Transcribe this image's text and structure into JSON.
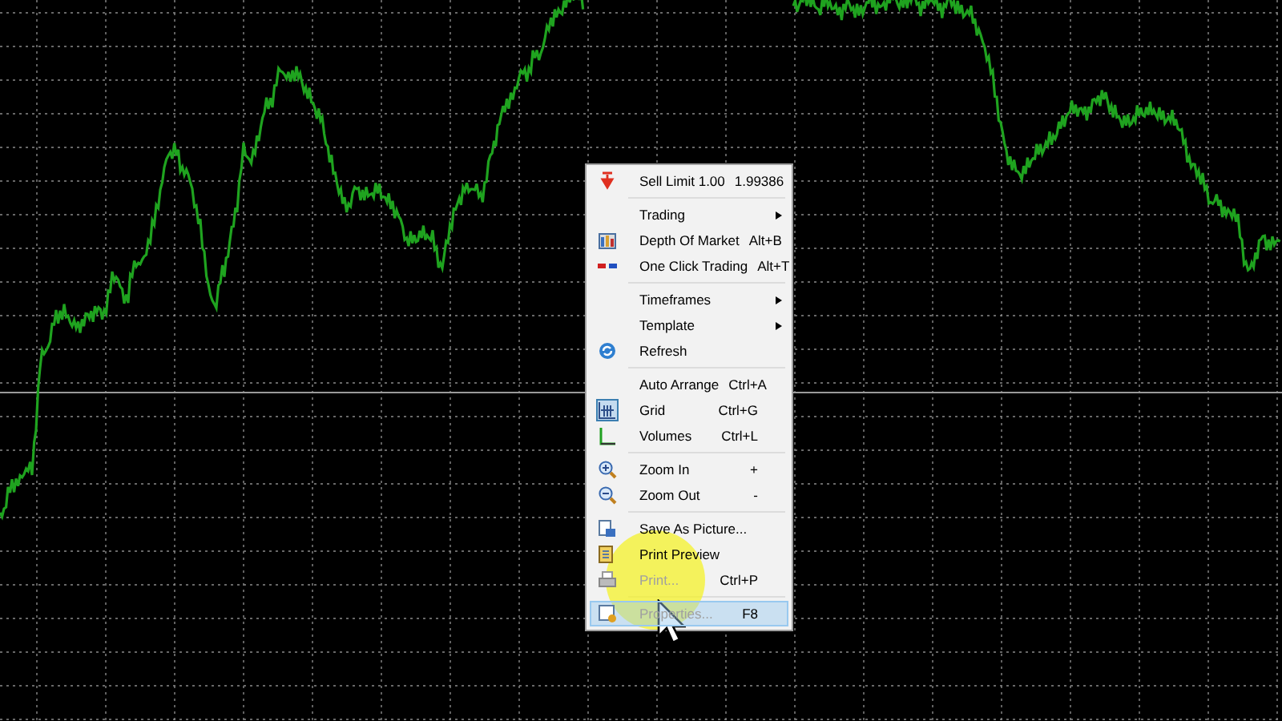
{
  "context_menu": {
    "items": [
      {
        "kind": "item",
        "label": "Sell Limit 1.00",
        "shortcut": "1.99386",
        "submenu": false,
        "checked": false,
        "disabled": false,
        "selected": false
      },
      {
        "kind": "separator"
      },
      {
        "kind": "item",
        "label": "Trading",
        "submenu": true,
        "checked": false,
        "disabled": false,
        "selected": false
      },
      {
        "kind": "item",
        "label": "Depth Of Market",
        "shortcut": "Alt+B",
        "submenu": false,
        "checked": false,
        "disabled": false,
        "selected": false
      },
      {
        "kind": "item",
        "label": "One Click Trading",
        "shortcut": "Alt+T",
        "submenu": false,
        "checked": false,
        "disabled": false,
        "selected": false
      },
      {
        "kind": "separator"
      },
      {
        "kind": "item",
        "label": "Timeframes",
        "submenu": true,
        "checked": false,
        "disabled": false,
        "selected": false
      },
      {
        "kind": "item",
        "label": "Template",
        "submenu": true,
        "checked": false,
        "disabled": false,
        "selected": false
      },
      {
        "kind": "item",
        "label": "Refresh",
        "submenu": false,
        "checked": false,
        "disabled": false,
        "selected": false
      },
      {
        "kind": "separator"
      },
      {
        "kind": "item",
        "label": "Auto Arrange",
        "shortcut": "Ctrl+A",
        "submenu": false,
        "checked": false,
        "disabled": false,
        "selected": false
      },
      {
        "kind": "item",
        "label": "Grid",
        "shortcut": "Ctrl+G",
        "submenu": false,
        "checked": true,
        "disabled": false,
        "selected": false
      },
      {
        "kind": "item",
        "label": "Volumes",
        "shortcut": "Ctrl+L",
        "submenu": false,
        "checked": false,
        "disabled": false,
        "selected": false
      },
      {
        "kind": "separator"
      },
      {
        "kind": "item",
        "label": "Zoom In",
        "shortcut": "+",
        "submenu": false,
        "checked": false,
        "disabled": false,
        "selected": false
      },
      {
        "kind": "item",
        "label": "Zoom Out",
        "shortcut": "-",
        "submenu": false,
        "checked": false,
        "disabled": false,
        "selected": false
      },
      {
        "kind": "separator"
      },
      {
        "kind": "item",
        "label": "Save As Picture...",
        "submenu": false,
        "checked": false,
        "disabled": false,
        "selected": false
      },
      {
        "kind": "item",
        "label": "Print Preview",
        "submenu": false,
        "checked": false,
        "disabled": false,
        "selected": false
      },
      {
        "kind": "item",
        "label": "Print...",
        "shortcut": "Ctrl+P",
        "submenu": false,
        "checked": false,
        "disabled": true,
        "selected": false
      },
      {
        "kind": "separator"
      },
      {
        "kind": "item",
        "label": "Properties...",
        "shortcut": "F8",
        "submenu": false,
        "checked": false,
        "disabled": true,
        "selected": true
      }
    ]
  }
}
